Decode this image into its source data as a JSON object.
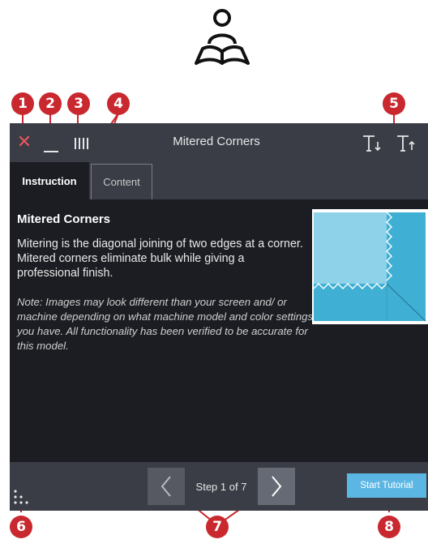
{
  "reader_icon": "person-reading-book-icon",
  "callouts": [
    "1",
    "2",
    "3",
    "4",
    "5",
    "6",
    "7",
    "8"
  ],
  "window": {
    "close_icon": "close-icon",
    "minimize_icon": "minimize-icon",
    "move_icon": "grip-icon",
    "title": "Mitered Corners",
    "text_size_decrease_icon": "text-size-decrease-icon",
    "text_size_increase_icon": "text-size-increase-icon"
  },
  "tabs": [
    {
      "label": "Instruction",
      "active": true
    },
    {
      "label": "Content",
      "active": false
    }
  ],
  "content": {
    "heading": "Mitered Corners",
    "paragraph": "Mitering is the diagonal joining of two edges at a corner. Mitered corners eliminate bulk while giving a professional finish.",
    "note": "Note: Images may look different than your screen and/ or machine depending on what machine model and color settings you have. All functionality has been verified to be accurate for this model."
  },
  "footer": {
    "step_text": "Step 1 of 7",
    "start_button": "Start Tutorial"
  },
  "colors": {
    "callout": "#c8282e",
    "close": "#e8565f",
    "window_bg": "#1b1d22",
    "bar_bg": "#3a3d46",
    "accent_blue": "#5cb6e4"
  }
}
